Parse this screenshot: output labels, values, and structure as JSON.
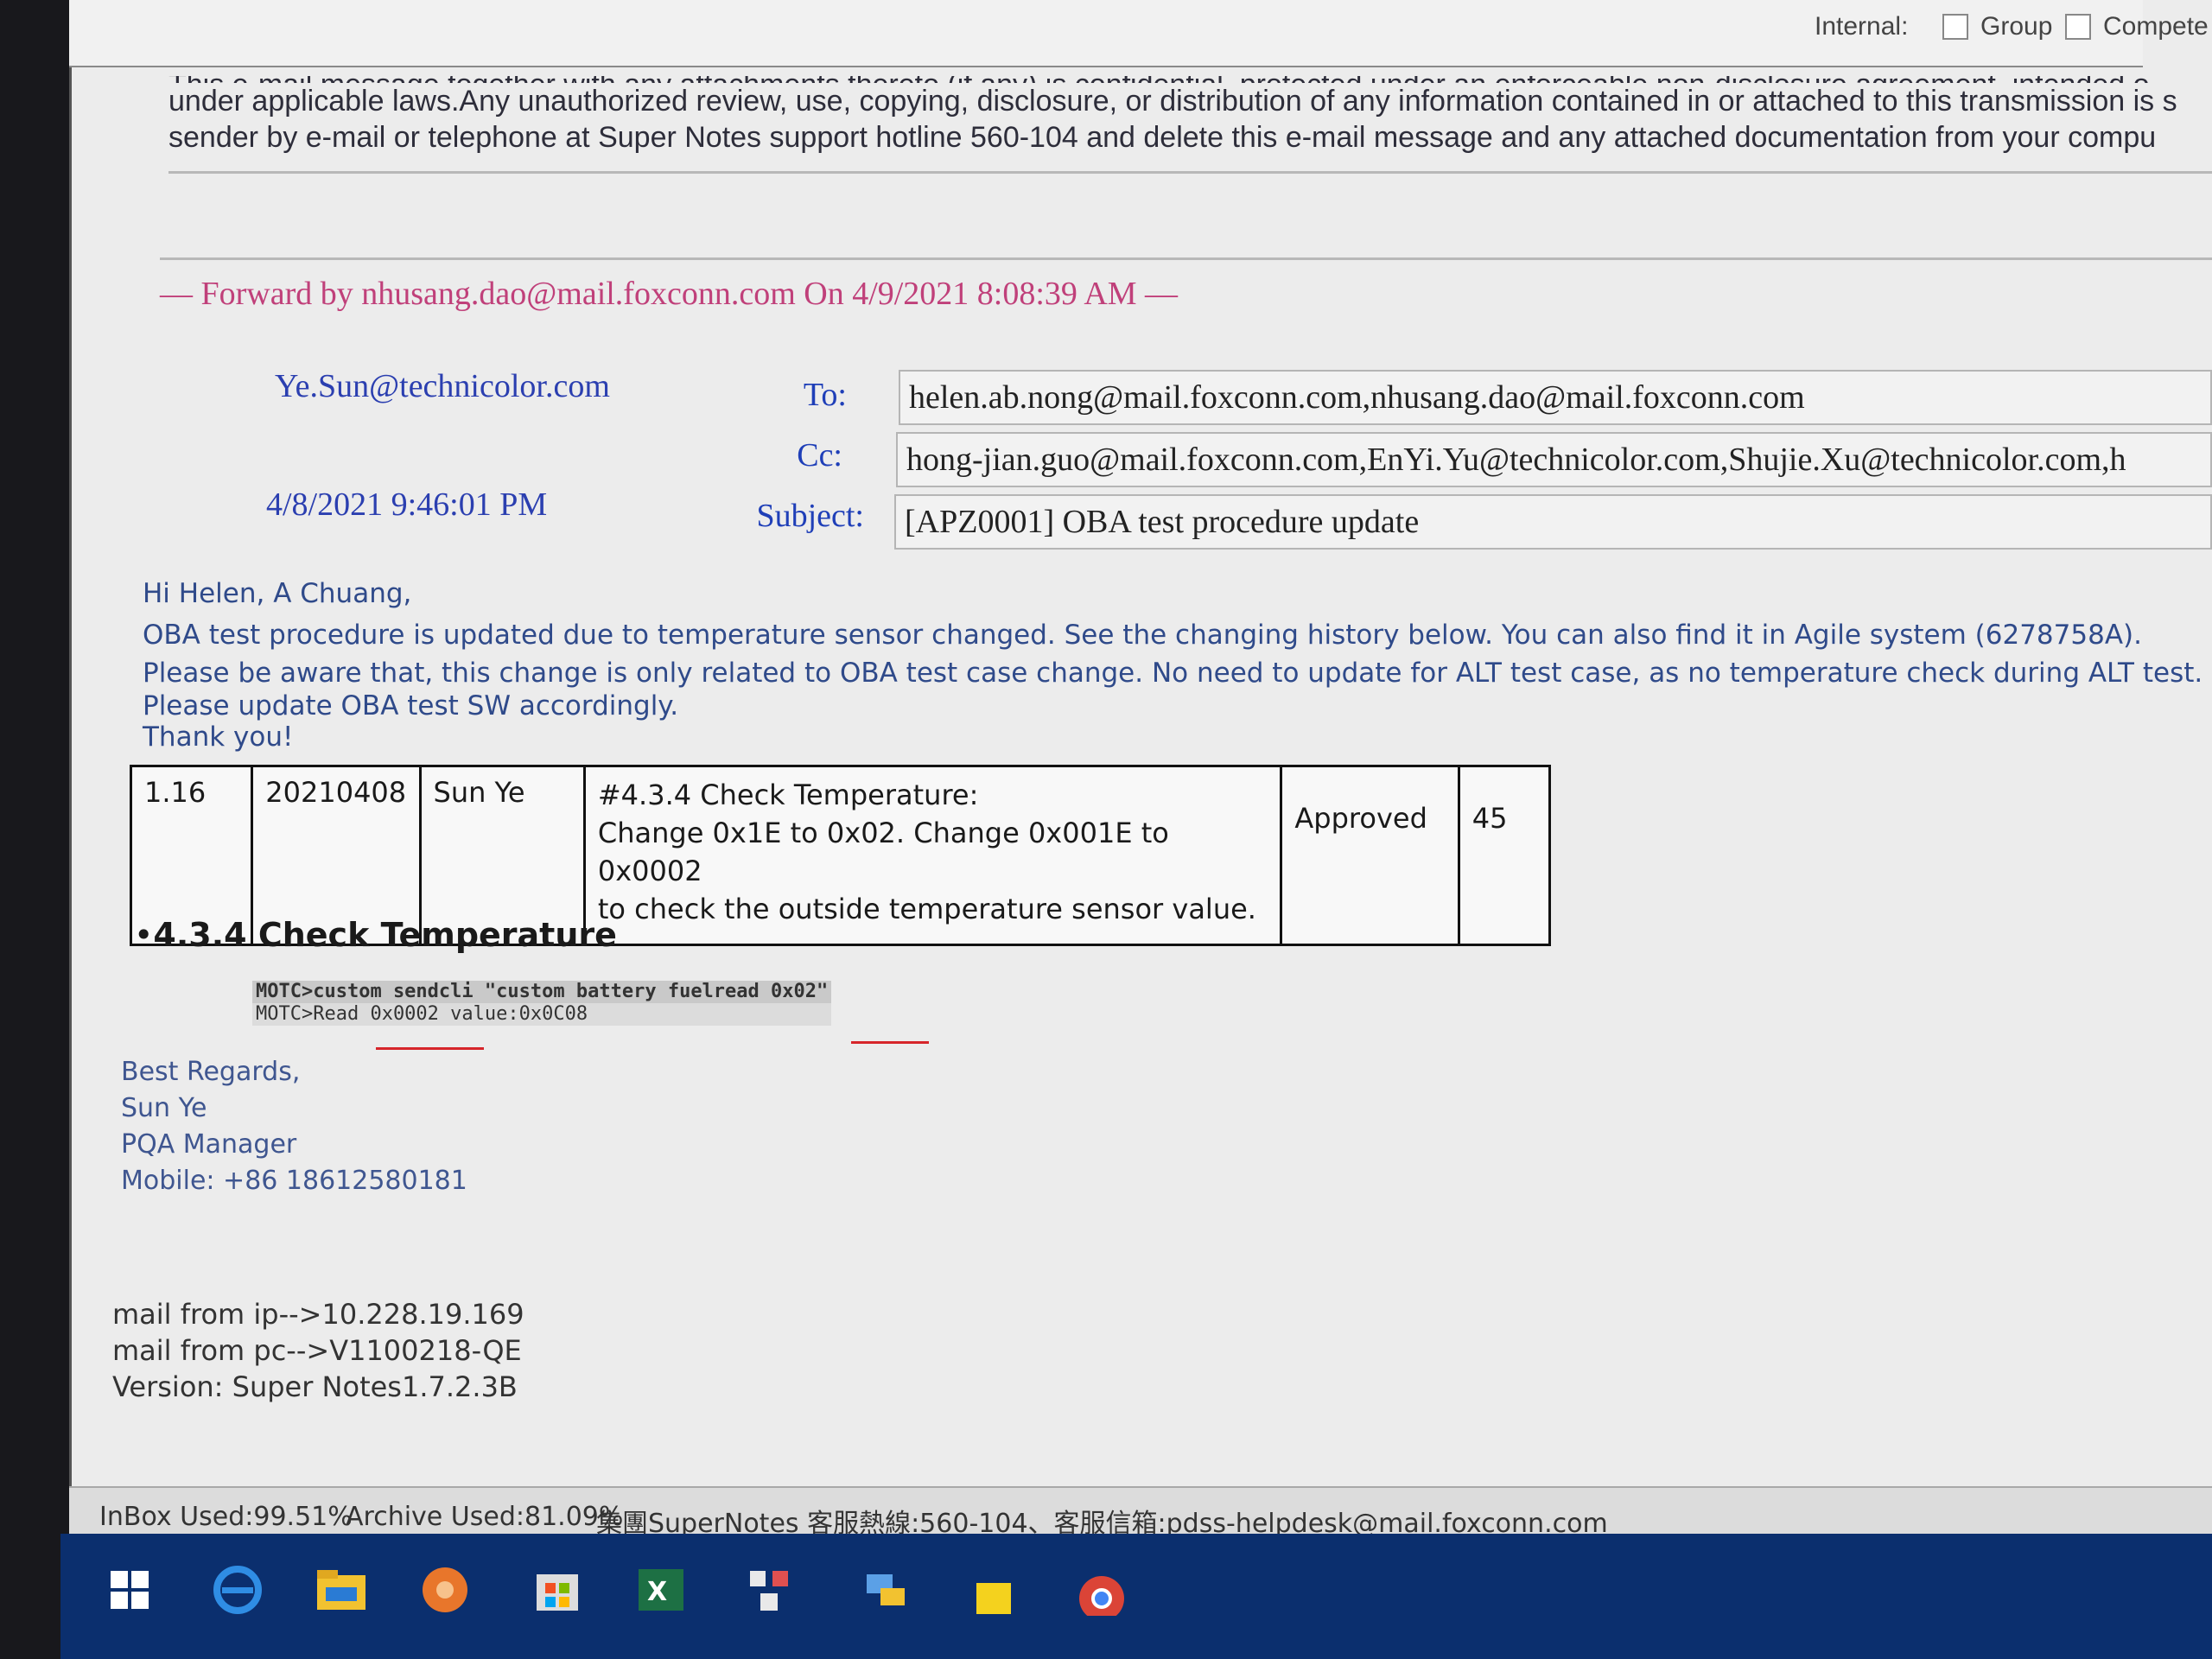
{
  "top_bar": {
    "internal_label": "Internal:",
    "group_label": "Group",
    "compete_label": "Compete"
  },
  "disclaimer": {
    "line0": "This e-mail message together with any attachments thereto (if any) is confidential, protected under an enforceable non-disclosure agreement, intended o",
    "line1": "under applicable laws.Any unauthorized review, use, copying, disclosure, or distribution of any information contained in or attached to this transmission is s",
    "line2": "sender by e-mail or telephone at Super Notes support hotline 560-104 and delete this e-mail message and any attached documentation from your compu"
  },
  "forward": {
    "text": "— Forward by nhusang.dao@mail.foxconn.com On 4/9/2021 8:08:39 AM —"
  },
  "header": {
    "from": "Ye.Sun@technicolor.com",
    "date": "4/8/2021 9:46:01 PM",
    "to_label": "To:",
    "cc_label": "Cc:",
    "subject_label": "Subject:",
    "to_value": "helen.ab.nong@mail.foxconn.com,nhusang.dao@mail.foxconn.com",
    "cc_value": "hong-jian.guo@mail.foxconn.com,EnYi.Yu@technicolor.com,Shujie.Xu@technicolor.com,h",
    "subject_value": "[APZ0001] OBA test procedure update"
  },
  "body": {
    "greeting": "Hi Helen, A Chuang,",
    "line1": "OBA test procedure is updated due to temperature sensor changed. See the changing history below. You can also find it in Agile system (6278758A).",
    "line2": "Please be aware that, this change is only related to OBA test case change. No need to update for ALT test case, as no temperature check during ALT test.",
    "line3": "Please update OBA test SW accordingly.",
    "thanks": "Thank you!"
  },
  "revision_table": {
    "version": "1.16",
    "date": "20210408",
    "author": "Sun Ye",
    "desc_title": "#4.3.4 Check Temperature:",
    "desc_line1": "Change 0x1E to 0x02. Change 0x001E to 0x0002",
    "desc_line2": "to check the outside temperature sensor value.",
    "status": "Approved",
    "page": "45"
  },
  "section": {
    "heading": "4.3.4 Check Temperature"
  },
  "cli": {
    "line1": "MOTC>custom sendcli \"custom battery fuelread 0x02\"",
    "line2": "MOTC>Read 0x0002 value:0x0C08"
  },
  "signature": {
    "regards": "Best Regards,",
    "name": "Sun Ye",
    "title": "PQA Manager",
    "mobile": "Mobile: +86 18612580181"
  },
  "mail_info": {
    "ip": "mail from ip-->10.228.19.169",
    "pc": "mail from pc-->V1100218-QE",
    "version": "Version: Super Notes1.7.2.3B"
  },
  "status_bar": {
    "inbox": "InBox Used:99.51%",
    "archive": "Archive Used:81.09%",
    "support": "集團SuperNotes 客服熱線:560-104、客服信箱:pdss-helpdesk@mail.foxconn.com"
  },
  "taskbar": {
    "icons": [
      "windows-start-icon",
      "edge-icon",
      "file-explorer-icon",
      "app-orange-icon",
      "store-icon",
      "excel-icon",
      "network-app-icon",
      "remote-desktop-icon",
      "sticky-icon",
      "chrome-icon"
    ]
  },
  "colors": {
    "forward_pink": "#c0407a",
    "header_blue": "#1f3fb8",
    "body_blue": "#2f4a8a",
    "taskbar": "#0b2f6e",
    "underline_red": "#d6252a"
  }
}
